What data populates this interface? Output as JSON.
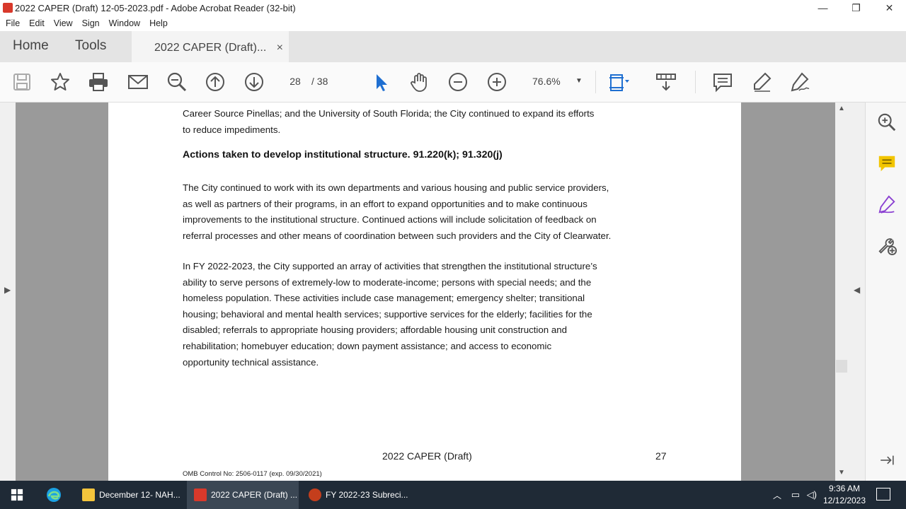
{
  "window": {
    "title": "2022 CAPER (Draft) 12-05-2023.pdf - Adobe Acrobat Reader (32-bit)",
    "minimize": "—",
    "maximize": "❐",
    "close": "✕"
  },
  "menu": [
    "File",
    "Edit",
    "View",
    "Sign",
    "Window",
    "Help"
  ],
  "tabs": {
    "home": "Home",
    "tools": "Tools",
    "doc": "2022 CAPER (Draft)...",
    "doc_close": "×"
  },
  "toolbar": {
    "page_current": "28",
    "page_total": "/ 38",
    "zoom": "76.6%",
    "zoom_caret": "▼"
  },
  "document": {
    "intro_line1": "Career Source Pinellas; and the University of South Florida; the City continued to expand its efforts",
    "intro_line2": "to reduce impediments.",
    "heading": "Actions taken to develop institutional structure. 91.220(k); 91.320(j)",
    "para1": [
      "The City continued to work with its own departments and various housing and public service providers,",
      "as well as partners of their programs, in an effort to expand opportunities and to make continuous",
      "improvements to the institutional structure. Continued actions will include solicitation of feedback on",
      "referral processes and other means of coordination between such providers and the City of Clearwater."
    ],
    "para2": [
      "In FY 2022-2023, the City supported an array of activities that strengthen the institutional structure’s",
      "ability to serve persons of extremely-low to moderate-income; persons with special needs; and the",
      "homeless population. These activities include case management; emergency shelter; transitional",
      "housing; behavioral and mental health services; supportive services for the elderly; facilities for the",
      "disabled; referrals to appropriate housing providers; affordable housing unit construction and",
      "rehabilitation; homebuyer education; down payment assistance; and access to economic",
      "opportunity technical assistance."
    ],
    "footer_title": "2022 CAPER (Draft)",
    "footer_page": "27",
    "omb": "OMB Control No: 2506-0117 (exp. 09/30/2021)"
  },
  "taskbar": {
    "items": [
      {
        "label": "December 12- NAH..."
      },
      {
        "label": "2022 CAPER (Draft) ..."
      },
      {
        "label": "FY 2022-23 Subreci..."
      }
    ],
    "time": "9:36 AM",
    "date": "12/12/2023"
  }
}
